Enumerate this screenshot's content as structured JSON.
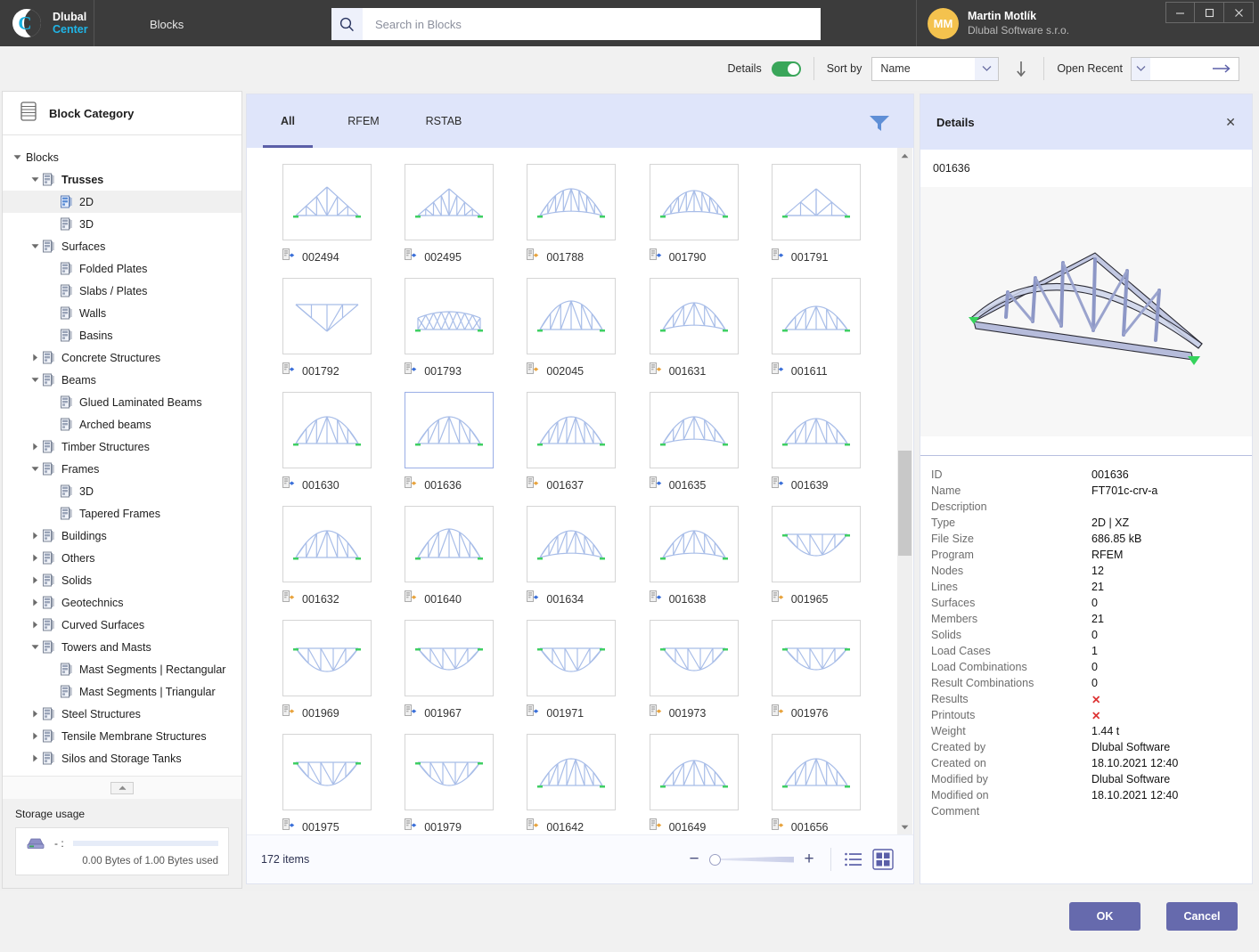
{
  "titlebar": {
    "brand_line1": "Dlubal",
    "brand_line2": "Center",
    "brand_mark": "C",
    "module": "Blocks",
    "user_initials": "MM",
    "user_name": "Martin Motlík",
    "user_org": "Dlubal Software s.r.o.",
    "minimize": "—",
    "maximize": "☐",
    "close": "✕"
  },
  "search": {
    "placeholder": "Search in Blocks",
    "value": ""
  },
  "toolbar": {
    "details_label": "Details",
    "details_on": true,
    "sort_by_label": "Sort by",
    "sort_by_value": "Name",
    "sort_direction": "descending",
    "open_recent_label": "Open Recent",
    "open_recent_value": ""
  },
  "sidebar": {
    "header": "Block Category",
    "tree": [
      {
        "label": "Blocks",
        "depth": 0,
        "twisty": "down",
        "icon": false,
        "bold": false,
        "selected": false
      },
      {
        "label": "Trusses",
        "depth": 1,
        "twisty": "down",
        "icon": true,
        "bold": true,
        "selected": false
      },
      {
        "label": "2D",
        "depth": 2,
        "twisty": "none",
        "icon": true,
        "bold": false,
        "selected": true
      },
      {
        "label": "3D",
        "depth": 2,
        "twisty": "none",
        "icon": true,
        "bold": false,
        "selected": false
      },
      {
        "label": "Surfaces",
        "depth": 1,
        "twisty": "down",
        "icon": true,
        "bold": false,
        "selected": false
      },
      {
        "label": "Folded Plates",
        "depth": 2,
        "twisty": "none",
        "icon": true,
        "bold": false,
        "selected": false
      },
      {
        "label": "Slabs / Plates",
        "depth": 2,
        "twisty": "none",
        "icon": true,
        "bold": false,
        "selected": false
      },
      {
        "label": "Walls",
        "depth": 2,
        "twisty": "none",
        "icon": true,
        "bold": false,
        "selected": false
      },
      {
        "label": "Basins",
        "depth": 2,
        "twisty": "none",
        "icon": true,
        "bold": false,
        "selected": false
      },
      {
        "label": "Concrete Structures",
        "depth": 1,
        "twisty": "right",
        "icon": true,
        "bold": false,
        "selected": false
      },
      {
        "label": "Beams",
        "depth": 1,
        "twisty": "down",
        "icon": true,
        "bold": false,
        "selected": false
      },
      {
        "label": "Glued Laminated Beams",
        "depth": 2,
        "twisty": "none",
        "icon": true,
        "bold": false,
        "selected": false
      },
      {
        "label": "Arched beams",
        "depth": 2,
        "twisty": "none",
        "icon": true,
        "bold": false,
        "selected": false
      },
      {
        "label": "Timber Structures",
        "depth": 1,
        "twisty": "right",
        "icon": true,
        "bold": false,
        "selected": false
      },
      {
        "label": "Frames",
        "depth": 1,
        "twisty": "down",
        "icon": true,
        "bold": false,
        "selected": false
      },
      {
        "label": "3D",
        "depth": 2,
        "twisty": "none",
        "icon": true,
        "bold": false,
        "selected": false
      },
      {
        "label": "Tapered Frames",
        "depth": 2,
        "twisty": "none",
        "icon": true,
        "bold": false,
        "selected": false
      },
      {
        "label": "Buildings",
        "depth": 1,
        "twisty": "right",
        "icon": true,
        "bold": false,
        "selected": false
      },
      {
        "label": "Others",
        "depth": 1,
        "twisty": "right",
        "icon": true,
        "bold": false,
        "selected": false
      },
      {
        "label": "Solids",
        "depth": 1,
        "twisty": "right",
        "icon": true,
        "bold": false,
        "selected": false
      },
      {
        "label": "Geotechnics",
        "depth": 1,
        "twisty": "right",
        "icon": true,
        "bold": false,
        "selected": false
      },
      {
        "label": "Curved Surfaces",
        "depth": 1,
        "twisty": "right",
        "icon": true,
        "bold": false,
        "selected": false
      },
      {
        "label": "Towers and Masts",
        "depth": 1,
        "twisty": "down",
        "icon": true,
        "bold": false,
        "selected": false
      },
      {
        "label": "Mast Segments | Rectangular",
        "depth": 2,
        "twisty": "none",
        "icon": true,
        "bold": false,
        "selected": false
      },
      {
        "label": "Mast Segments | Triangular",
        "depth": 2,
        "twisty": "none",
        "icon": true,
        "bold": false,
        "selected": false
      },
      {
        "label": "Steel Structures",
        "depth": 1,
        "twisty": "right",
        "icon": true,
        "bold": false,
        "selected": false
      },
      {
        "label": "Tensile Membrane Structures",
        "depth": 1,
        "twisty": "right",
        "icon": true,
        "bold": false,
        "selected": false
      },
      {
        "label": "Silos and Storage Tanks",
        "depth": 1,
        "twisty": "right",
        "icon": true,
        "bold": false,
        "selected": false
      }
    ],
    "storage": {
      "title": "Storage usage",
      "drive_label": "- :",
      "usage_text": "0.00 Bytes of 1.00 Bytes used",
      "percent": 0
    }
  },
  "center": {
    "tabs": [
      {
        "label": "All",
        "active": true
      },
      {
        "label": "RFEM",
        "active": false
      },
      {
        "label": "RSTAB",
        "active": false
      }
    ],
    "items": [
      {
        "id": "002494",
        "shape": "pitched-truss-1",
        "badge": "blue"
      },
      {
        "id": "002495",
        "shape": "pitched-truss-2",
        "badge": "blue"
      },
      {
        "id": "001788",
        "shape": "curved-top-truss-1",
        "badge": "orange"
      },
      {
        "id": "001790",
        "shape": "curved-top-truss-2",
        "badge": "blue"
      },
      {
        "id": "001791",
        "shape": "pitched-truss-3",
        "badge": "blue"
      },
      {
        "id": "001792",
        "shape": "inverted-truss-1",
        "badge": "blue"
      },
      {
        "id": "001793",
        "shape": "lattice-truss",
        "badge": "blue"
      },
      {
        "id": "002045",
        "shape": "arch-truss-1",
        "badge": "orange"
      },
      {
        "id": "001631",
        "shape": "arch-truss-2",
        "badge": "orange"
      },
      {
        "id": "001611",
        "shape": "arch-truss-3",
        "badge": "blue"
      },
      {
        "id": "001630",
        "shape": "arch-truss-4",
        "badge": "blue"
      },
      {
        "id": "001636",
        "shape": "arch-truss-5",
        "badge": "orange"
      },
      {
        "id": "001637",
        "shape": "arch-truss-6",
        "badge": "orange"
      },
      {
        "id": "001635",
        "shape": "arch-truss-7",
        "badge": "blue"
      },
      {
        "id": "001639",
        "shape": "arch-truss-8",
        "badge": "blue"
      },
      {
        "id": "001632",
        "shape": "arch-truss-9",
        "badge": "orange"
      },
      {
        "id": "001640",
        "shape": "arch-truss-10",
        "badge": "orange"
      },
      {
        "id": "001634",
        "shape": "arch-truss-11",
        "badge": "blue"
      },
      {
        "id": "001638",
        "shape": "arch-truss-12",
        "badge": "blue"
      },
      {
        "id": "001965",
        "shape": "bowstring-down-1",
        "badge": "orange"
      },
      {
        "id": "001969",
        "shape": "bowstring-down-2",
        "badge": "orange"
      },
      {
        "id": "001967",
        "shape": "bowstring-down-3",
        "badge": "blue"
      },
      {
        "id": "001971",
        "shape": "bowstring-down-4",
        "badge": "blue"
      },
      {
        "id": "001973",
        "shape": "bowstring-down-5",
        "badge": "orange"
      },
      {
        "id": "001976",
        "shape": "bowstring-down-6",
        "badge": "orange"
      },
      {
        "id": "001975",
        "shape": "bowstring-down-7",
        "badge": "blue"
      },
      {
        "id": "001979",
        "shape": "bowstring-down-8",
        "badge": "blue"
      },
      {
        "id": "001642",
        "shape": "arch-truss-13",
        "badge": "orange"
      },
      {
        "id": "001649",
        "shape": "arch-truss-14",
        "badge": "orange"
      },
      {
        "id": "001656",
        "shape": "arch-truss-15",
        "badge": "orange"
      }
    ],
    "selected_id": "001636",
    "status": {
      "items_text": "172 items",
      "zoom_minus": "−",
      "zoom_plus": "+"
    }
  },
  "details": {
    "title": "Details",
    "close": "✕",
    "id_header": "001636",
    "properties": [
      {
        "key": "ID",
        "value": "001636"
      },
      {
        "key": "Name",
        "value": "FT701c-crv-a"
      },
      {
        "key": "Description",
        "value": ""
      },
      {
        "key": "Type",
        "value": "2D | XZ"
      },
      {
        "key": "File Size",
        "value": "686.85 kB"
      },
      {
        "key": "Program",
        "value": "RFEM"
      },
      {
        "key": "Nodes",
        "value": "12"
      },
      {
        "key": "Lines",
        "value": "21"
      },
      {
        "key": "Surfaces",
        "value": "0"
      },
      {
        "key": "Members",
        "value": "21"
      },
      {
        "key": "Solids",
        "value": "0"
      },
      {
        "key": "Load Cases",
        "value": "1"
      },
      {
        "key": "Load Combinations",
        "value": "0"
      },
      {
        "key": "Result Combinations",
        "value": "0"
      },
      {
        "key": "Results",
        "value": "✕",
        "red": true
      },
      {
        "key": "Printouts",
        "value": "✕",
        "red": true
      },
      {
        "key": "Weight",
        "value": "1.44 t"
      },
      {
        "key": "Created by",
        "value": "Dlubal Software"
      },
      {
        "key": "Created on",
        "value": "18.10.2021 12:40"
      },
      {
        "key": "Modified by",
        "value": "Dlubal Software"
      },
      {
        "key": "Modified on",
        "value": "18.10.2021 12:40"
      },
      {
        "key": "Comment",
        "value": ""
      }
    ]
  },
  "footer": {
    "ok": "OK",
    "cancel": "Cancel"
  },
  "colors": {
    "titlebar_bg": "#3c3c3c",
    "accent_cyan": "#1fb6e8",
    "tab_bg": "#dfe5fa",
    "button_purple": "#666aad",
    "toggle_green": "#3aa65a",
    "avatar_yellow": "#f4c24e",
    "truss_line": "#a8bde8"
  }
}
